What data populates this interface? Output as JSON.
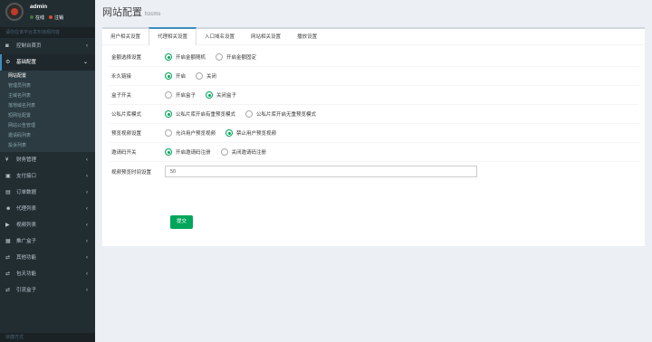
{
  "user": {
    "name": "admin",
    "online": "在线",
    "logout": "注销"
  },
  "sidebar": {
    "header": "请勿在该平台发布违规内容",
    "items": [
      {
        "icon": "dashboard-icon",
        "glyph": "◙",
        "label": "控制台首页"
      },
      {
        "icon": "gear-icon",
        "glyph": "⚙",
        "label": "基础配置",
        "active": true,
        "sub": [
          "网站配置",
          "管理员列表",
          "主域名列表",
          "落地域名列表",
          "短网址配置",
          "网站公告管理",
          "邀请码列表",
          "投诉列表"
        ]
      },
      {
        "icon": "money-icon",
        "glyph": "¥",
        "label": "财务管理"
      },
      {
        "icon": "payment-icon",
        "glyph": "▣",
        "label": "支付接口"
      },
      {
        "icon": "order-icon",
        "glyph": "▤",
        "label": "订单数据"
      },
      {
        "icon": "users-icon",
        "glyph": "☻",
        "label": "代理列表"
      },
      {
        "icon": "video-icon",
        "glyph": "▶",
        "label": "视频列表"
      },
      {
        "icon": "box-icon",
        "glyph": "▦",
        "label": "推广盒子"
      },
      {
        "icon": "settings-icon",
        "glyph": "⇄",
        "label": "其他功能"
      },
      {
        "icon": "package-icon",
        "glyph": "⇄",
        "label": "包天功能"
      },
      {
        "icon": "gift-icon",
        "glyph": "⇄",
        "label": "引流盒子"
      }
    ],
    "footer": "快捷方式"
  },
  "page": {
    "title": "网站配置",
    "subtitle": "hzcms"
  },
  "tabs": [
    "用户相关设置",
    "代理相关设置",
    "入口域名设置",
    "网站相关设置",
    "播放设置"
  ],
  "active_tab": 1,
  "form": {
    "rows": [
      {
        "label": "金额选择设置",
        "options": [
          "开启金额随机",
          "开启金额固定"
        ],
        "selected": 0
      },
      {
        "label": "永久链接",
        "options": [
          "开启",
          "关闭"
        ],
        "selected": 0
      },
      {
        "label": "盒子开关",
        "options": [
          "开启盒子",
          "关闭盒子"
        ],
        "selected": 1
      },
      {
        "label": "公私片库模式",
        "options": [
          "公私片库开启有重预览模式",
          "公私片库开启无重预览模式"
        ],
        "selected": 0
      },
      {
        "label": "预览视频设置",
        "options": [
          "允许用户预览视频",
          "禁止用户预览视频"
        ],
        "selected": 1
      },
      {
        "label": "邀请码开关",
        "options": [
          "开启邀请码注册",
          "关闭邀请码注册"
        ],
        "selected": 0
      }
    ],
    "preview_time_label": "视频预览时间设置",
    "preview_time_value": "50",
    "submit_label": "提交"
  },
  "colors": {
    "sidebar_bg": "#222d32",
    "accent": "#3c8dbc",
    "success": "#00a65a"
  }
}
